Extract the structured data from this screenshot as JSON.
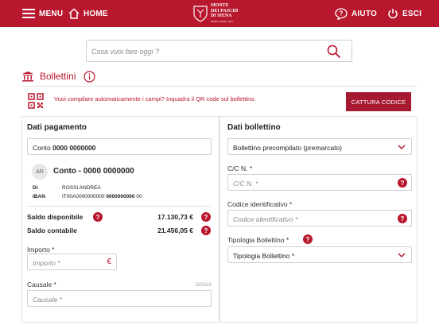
{
  "header": {
    "menu_label": "MENU",
    "home_label": "HOME",
    "logo_line1": "MONTE",
    "logo_line2": "DEI PASCHI",
    "logo_line3": "DI SIENA",
    "logo_line4": "BANCA DAL 1472",
    "help_label": "AIUTO",
    "exit_label": "ESCI",
    "brand_color": "#b8172e"
  },
  "search": {
    "placeholder": "Cosa vuoi fare oggi ?"
  },
  "section": {
    "title": "Bollettini"
  },
  "qr": {
    "text": "Vuoi compilare automaticamente i campi? Inquadra il QR code sul bollettino.",
    "button_label": "CATTURA CODICE"
  },
  "left_panel": {
    "title": "Dati pagamento",
    "conto_prefix": "Conto ",
    "conto_number": "0000 0000000",
    "avatar_initials": "AR",
    "conto_title": "Conto - 0000 0000000",
    "di_label": "Di",
    "di_value": "ROSSI ANDREA",
    "iban_label": "IBAN",
    "iban_part1": "IT00A0000000000 ",
    "iban_part2": "0000000000",
    "iban_part3": " 00",
    "saldo_disponibile_label": "Saldo disponibile",
    "saldo_disponibile_value": "17.130,73 €",
    "saldo_contabile_label": "Saldo contabile",
    "saldo_contabile_value": "21.456,05 €",
    "importo_label": "Importo *",
    "importo_placeholder": "Importo *",
    "euro_symbol": "€",
    "causale_label": "Causale *",
    "causale_counter": "110/110",
    "causale_placeholder": "Causale *"
  },
  "right_panel": {
    "title": "Dati bollettino",
    "tipo_select_value": "Bollettino precompilato (premarcato)",
    "cc_label": "C/C N. *",
    "cc_placeholder": "C/C N. *",
    "codice_label": "Codice identificativo *",
    "codice_placeholder": "Codice identificativo *",
    "tipologia_label": "Tipologia Bollettino *",
    "tipologia_value": "Tipologia Bollettino *"
  },
  "help_glyph": "?"
}
